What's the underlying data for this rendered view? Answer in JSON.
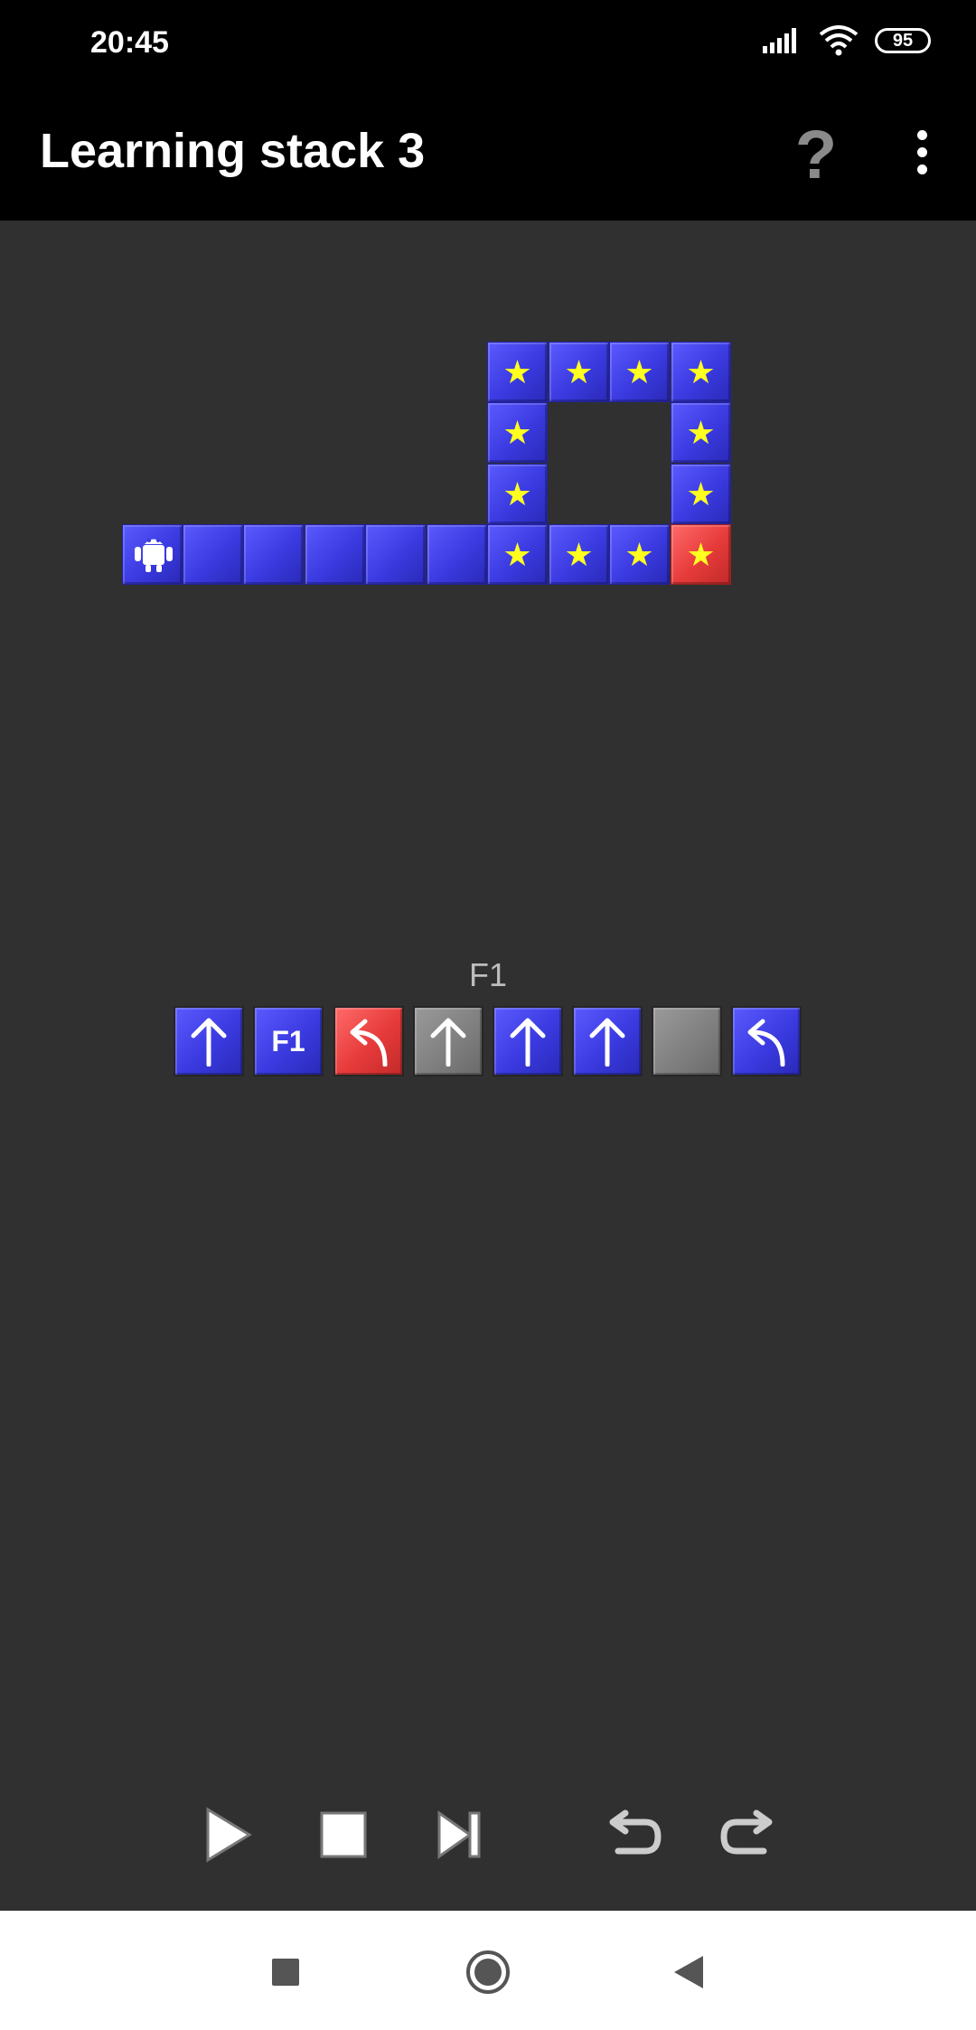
{
  "status_bar": {
    "time": "20:45",
    "battery": "95",
    "icons": [
      "signal-icon",
      "wifi-icon",
      "battery-icon"
    ]
  },
  "app_bar": {
    "title": "Learning stack 3",
    "help_label": "?",
    "icons": [
      "help-icon",
      "overflow-menu-icon"
    ]
  },
  "board": {
    "colors": {
      "tile": "#3a3ae0",
      "goal": "#e63a3a",
      "star": "#ffff20",
      "background": "#303030"
    },
    "robot_icon": "android-robot-icon",
    "star_glyph": "★"
  },
  "program": {
    "function_label": "F1",
    "commands": [
      {
        "label": "",
        "icon": "arrow-up-icon",
        "color": "blue"
      },
      {
        "label": "F1",
        "icon": "",
        "color": "blue"
      },
      {
        "label": "",
        "icon": "turn-left-icon",
        "color": "red"
      },
      {
        "label": "",
        "icon": "arrow-up-icon",
        "color": "gray"
      },
      {
        "label": "",
        "icon": "arrow-up-icon",
        "color": "blue"
      },
      {
        "label": "",
        "icon": "arrow-up-icon",
        "color": "blue"
      },
      {
        "label": "",
        "icon": "empty-slot",
        "color": "gray"
      },
      {
        "label": "",
        "icon": "turn-left-icon",
        "color": "blue"
      }
    ]
  },
  "controls": {
    "icons": [
      "play-icon",
      "stop-icon",
      "step-icon",
      "undo-icon",
      "redo-icon"
    ]
  },
  "nav_bar": {
    "icons": [
      "recents-square-icon",
      "home-circle-icon",
      "back-triangle-icon"
    ]
  }
}
